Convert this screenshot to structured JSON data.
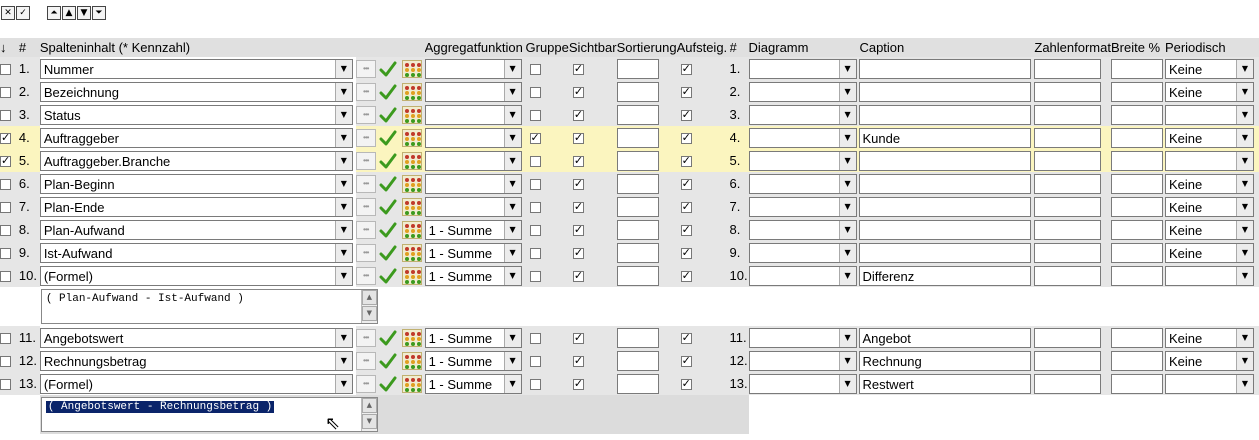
{
  "toolbar_left": [
    {
      "icon": "close-icon",
      "glyph": "✕"
    },
    {
      "icon": "check-icon",
      "glyph": "✓"
    }
  ],
  "toolbar_right": [
    {
      "icon": "move-top-icon",
      "glyph": "⏶"
    },
    {
      "icon": "move-up-icon",
      "glyph": "▲"
    },
    {
      "icon": "move-down-icon",
      "glyph": "▼"
    },
    {
      "icon": "move-bottom-icon",
      "glyph": "⏷"
    }
  ],
  "headers": {
    "sort_icon": "↓",
    "num": "#",
    "column": "Spalteninhalt (* Kennzahl)",
    "aggregate": "Aggregatfunktion",
    "group": "Gruppe",
    "visible": "Sichtbar",
    "sort": "Sortierung",
    "ascending": "Aufsteig.",
    "num2": "#",
    "chart": "Diagramm",
    "caption": "Caption",
    "numformat": "Zahlenformat",
    "width": "Breite %",
    "periodic": "Periodisch"
  },
  "rows": [
    {
      "selected": false,
      "num": "1.",
      "content": "Nummer",
      "agg": "",
      "group": false,
      "visible": true,
      "sort": "",
      "asc": true,
      "num2": "1.",
      "chart": "",
      "caption": "",
      "numformat": "",
      "width": "",
      "periodic": "Keine",
      "highlight": false
    },
    {
      "selected": false,
      "num": "2.",
      "content": "Bezeichnung",
      "agg": "",
      "group": false,
      "visible": true,
      "sort": "",
      "asc": true,
      "num2": "2.",
      "chart": "",
      "caption": "",
      "numformat": "",
      "width": "",
      "periodic": "Keine",
      "highlight": false
    },
    {
      "selected": false,
      "num": "3.",
      "content": "Status",
      "agg": "",
      "group": false,
      "visible": true,
      "sort": "",
      "asc": true,
      "num2": "3.",
      "chart": "",
      "caption": "",
      "numformat": "",
      "width": "",
      "periodic": "",
      "highlight": false
    },
    {
      "selected": true,
      "num": "4.",
      "content": "Auftraggeber",
      "agg": "",
      "group": true,
      "visible": true,
      "sort": "",
      "asc": true,
      "num2": "4.",
      "chart": "",
      "caption": "Kunde",
      "numformat": "",
      "width": "",
      "periodic": "Keine",
      "highlight": true
    },
    {
      "selected": true,
      "num": "5.",
      "content": "Auftraggeber.Branche",
      "agg": "",
      "group": false,
      "visible": true,
      "sort": "",
      "asc": true,
      "num2": "5.",
      "chart": "",
      "caption": "",
      "numformat": "",
      "width": "",
      "periodic": "",
      "highlight": true
    },
    {
      "selected": false,
      "num": "6.",
      "content": "Plan-Beginn",
      "agg": "",
      "group": false,
      "visible": true,
      "sort": "",
      "asc": true,
      "num2": "6.",
      "chart": "",
      "caption": "",
      "numformat": "",
      "width": "",
      "periodic": "Keine",
      "highlight": false
    },
    {
      "selected": false,
      "num": "7.",
      "content": "Plan-Ende",
      "agg": "",
      "group": false,
      "visible": true,
      "sort": "",
      "asc": true,
      "num2": "7.",
      "chart": "",
      "caption": "",
      "numformat": "",
      "width": "",
      "periodic": "Keine",
      "highlight": false
    },
    {
      "selected": false,
      "num": "8.",
      "content": "Plan-Aufwand",
      "agg": "1 - Summe",
      "group": false,
      "visible": true,
      "sort": "",
      "asc": true,
      "num2": "8.",
      "chart": "",
      "caption": "",
      "numformat": "",
      "width": "",
      "periodic": "Keine",
      "highlight": false
    },
    {
      "selected": false,
      "num": "9.",
      "content": "Ist-Aufwand",
      "agg": "1 - Summe",
      "group": false,
      "visible": true,
      "sort": "",
      "asc": true,
      "num2": "9.",
      "chart": "",
      "caption": "",
      "numformat": "",
      "width": "",
      "periodic": "Keine",
      "highlight": false
    },
    {
      "selected": false,
      "num": "10.",
      "content": "(Formel)",
      "agg": "1 - Summe",
      "group": false,
      "visible": true,
      "sort": "",
      "asc": true,
      "num2": "10.",
      "chart": "",
      "caption": "Differenz",
      "numformat": "",
      "width": "",
      "periodic": "",
      "highlight": false,
      "formula": "( Plan-Aufwand - Ist-Aufwand )",
      "formula_selected": false
    },
    {
      "selected": false,
      "num": "11.",
      "content": "Angebotswert",
      "agg": "1 - Summe",
      "group": false,
      "visible": true,
      "sort": "",
      "asc": true,
      "num2": "11.",
      "chart": "",
      "caption": "Angebot",
      "numformat": "",
      "width": "",
      "periodic": "Keine",
      "highlight": false
    },
    {
      "selected": false,
      "num": "12.",
      "content": "Rechnungsbetrag",
      "agg": "1 - Summe",
      "group": false,
      "visible": true,
      "sort": "",
      "asc": true,
      "num2": "12.",
      "chart": "",
      "caption": "Rechnung",
      "numformat": "",
      "width": "",
      "periodic": "Keine",
      "highlight": false
    },
    {
      "selected": false,
      "num": "13.",
      "content": "(Formel)",
      "agg": "1 - Summe",
      "group": false,
      "visible": true,
      "sort": "",
      "asc": true,
      "num2": "13.",
      "chart": "",
      "caption": "Restwert",
      "numformat": "",
      "width": "",
      "periodic": "",
      "highlight": false,
      "formula": "( Angebotswert - Rechnungsbetrag )",
      "formula_selected": true
    }
  ],
  "colors": {
    "highlight": "#fbf5bf",
    "row_bg": "#e6e6e6",
    "header_bg": "#e0e0e0",
    "check_green": "#3c9a1e",
    "selection": "#0a246a"
  }
}
